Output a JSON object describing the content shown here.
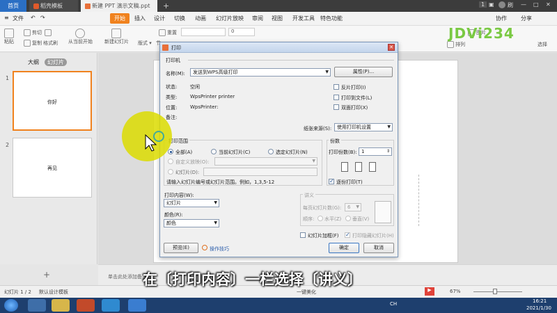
{
  "tabs": {
    "home": "首页",
    "wps": "稻壳模板",
    "doc": "新建 PPT 演示文稿.ppt",
    "badge": "1",
    "user": "刷"
  },
  "menu": {
    "file": "文件",
    "start": "开始",
    "insert": "插入",
    "design": "设计",
    "switch": "切换",
    "animation": "动画",
    "slideshow": "幻灯片放映",
    "review": "审阅",
    "view": "视图",
    "developer": "开发工具",
    "features": "特色功能",
    "collab": "协作",
    "share": "分享"
  },
  "ribbon": {
    "paste": "粘贴",
    "cut": "剪切",
    "copy": "复制",
    "format_painter": "格式刷",
    "from_current": "从当前开始",
    "new_slide": "新建幻灯片",
    "layout": "版式",
    "section": "节",
    "reset": "重置",
    "font_size": "0",
    "picture": "图片",
    "arrange": "排列",
    "select": "选择"
  },
  "left_panel": {
    "outline_tab": "大纲",
    "slides_tab": "幻灯片",
    "slides": [
      {
        "num": "1",
        "text": "你好"
      },
      {
        "num": "2",
        "text": "再见"
      }
    ],
    "add": "+"
  },
  "canvas": {
    "note_hint": "单击此处添加备注"
  },
  "statusbar": {
    "slide_count": "幻灯片 1 / 2",
    "template": "默认设计模板",
    "beautify": "一键美化",
    "zoom": "67%"
  },
  "taskbar": {
    "lang": "CH",
    "time": "16:21",
    "date": "2021/1/30"
  },
  "dialog": {
    "title": "打印",
    "printer_section": "打印机",
    "name_label": "名称(M):",
    "name_value": "发送到WPS高级打印",
    "properties_btn": "属性(P)...",
    "status_label": "状态:",
    "status_value": "空闲",
    "type_label": "类型:",
    "type_value": "WpsPrinter printer",
    "location_label": "位置:",
    "location_value": "WpsPrinter:",
    "comment_label": "备注:",
    "reverse_print": "反片打印(I)",
    "print_to_file": "打印到文件(L)",
    "duplex": "双面打印(X)",
    "paper_source_label": "纸张来源(S):",
    "paper_source_value": "使用打印机设置",
    "range_section": "打印范围",
    "range_all": "全部(A)",
    "range_current": "当前幻灯片(C)",
    "range_selection": "选定幻灯片(N)",
    "range_custom": "自定义放映(O):",
    "range_slides": "幻灯片(D):",
    "range_hint": "请输入幻灯片编号或幻灯片范围。例如，1,3,5-12",
    "copies_section": "份数",
    "copies_label": "打印份数(B):",
    "copies_value": "1",
    "collate": "逐份打印(T)",
    "content_label": "打印内容(W):",
    "content_value": "幻灯片",
    "color_label": "颜色(R):",
    "color_value": "颜色",
    "handout_section": "讲义",
    "per_page_label": "每页幻灯片数(G):",
    "per_page_value": "6",
    "order_label": "顺序:",
    "order_horizontal": "水平(Z)",
    "order_vertical": "垂直(V)",
    "frame": "幻灯片加框(F)",
    "print_hidden": "打印隐藏幻灯片(H)",
    "preview_btn": "预览(E)",
    "tips": "操作技巧",
    "ok_btn": "确定",
    "cancel_btn": "取消"
  },
  "overlay": {
    "subtitle": "在〔打印内容〕一栏选择〔讲义〕",
    "watermark": "JDVi234"
  }
}
